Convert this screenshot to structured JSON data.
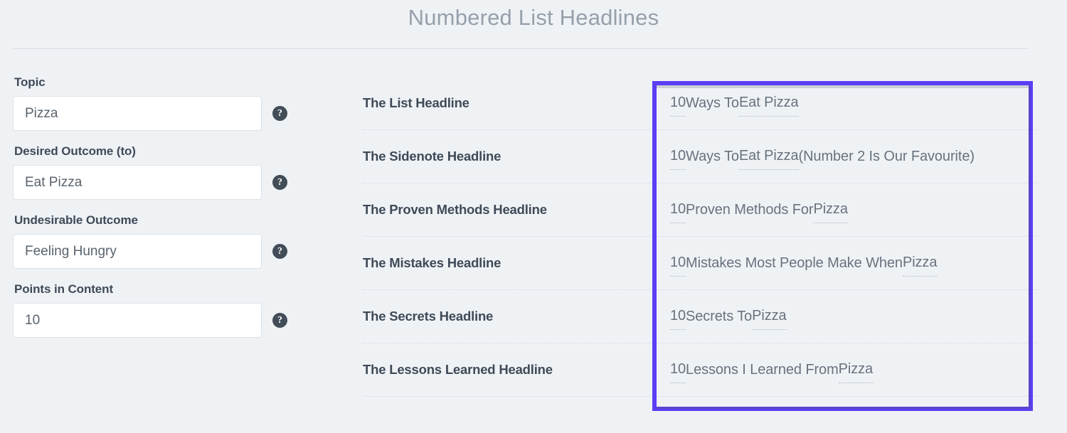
{
  "page": {
    "title": "Numbered List Headlines"
  },
  "form": {
    "fields": [
      {
        "label": "Topic",
        "value": "Pizza",
        "placeholder": "Topic",
        "help": "?"
      },
      {
        "label": "Desired Outcome (to)",
        "value": "Eat Pizza",
        "placeholder": "Desired Outcome (to)",
        "help": "?"
      },
      {
        "label": "Undesirable Outcome",
        "value": "Feeling Hungry",
        "placeholder": "Undesirable Outcome",
        "help": "?"
      },
      {
        "label": "Points in Content",
        "value": "10",
        "placeholder": "Points in Content",
        "help": "?"
      }
    ]
  },
  "results": {
    "rows": [
      {
        "label": "The List Headline",
        "parts": [
          {
            "text": "10",
            "variable": true
          },
          {
            "text": " Ways To ",
            "variable": false
          },
          {
            "text": "Eat Pizza",
            "variable": true
          }
        ],
        "full_text": "10 Ways To Eat Pizza"
      },
      {
        "label": "The Sidenote Headline",
        "parts": [
          {
            "text": "10",
            "variable": true
          },
          {
            "text": " Ways To ",
            "variable": false
          },
          {
            "text": "Eat Pizza",
            "variable": true
          },
          {
            "text": " (Number 2 Is Our Favourite)",
            "variable": false
          }
        ],
        "full_text": "10 Ways To Eat Pizza (Number 2 Is Our Favourite)"
      },
      {
        "label": "The Proven Methods Headline",
        "parts": [
          {
            "text": "10",
            "variable": true
          },
          {
            "text": " Proven Methods For ",
            "variable": false
          },
          {
            "text": "Pizza",
            "variable": true
          }
        ],
        "full_text": "10 Proven Methods For Pizza"
      },
      {
        "label": "The Mistakes Headline",
        "parts": [
          {
            "text": "10",
            "variable": true
          },
          {
            "text": " Mistakes Most People Make When ",
            "variable": false
          },
          {
            "text": "Pizza",
            "variable": true
          }
        ],
        "full_text": "10 Mistakes Most People Make When Pizza"
      },
      {
        "label": "The Secrets Headline",
        "parts": [
          {
            "text": "10",
            "variable": true
          },
          {
            "text": " Secrets To ",
            "variable": false
          },
          {
            "text": "Pizza",
            "variable": true
          }
        ],
        "full_text": "10 Secrets To Pizza"
      },
      {
        "label": "The Lessons Learned Headline",
        "parts": [
          {
            "text": "10",
            "variable": true
          },
          {
            "text": " Lessons I Learned From ",
            "variable": false
          },
          {
            "text": "Pizza",
            "variable": true
          }
        ],
        "full_text": "10 Lessons I Learned From Pizza"
      }
    ]
  },
  "highlight": {
    "color": "#5b3df5",
    "target": "headline-values-column"
  },
  "colors": {
    "background": "#eff2f5",
    "title_text": "#96a0ab",
    "label_text": "#3f4a57",
    "value_text": "#68727d",
    "input_background": "#ffffff",
    "input_border": "#dde2e8",
    "divider": "#d3d9e0",
    "help_icon": "#424d58",
    "highlight_border": "#5b3df5"
  }
}
